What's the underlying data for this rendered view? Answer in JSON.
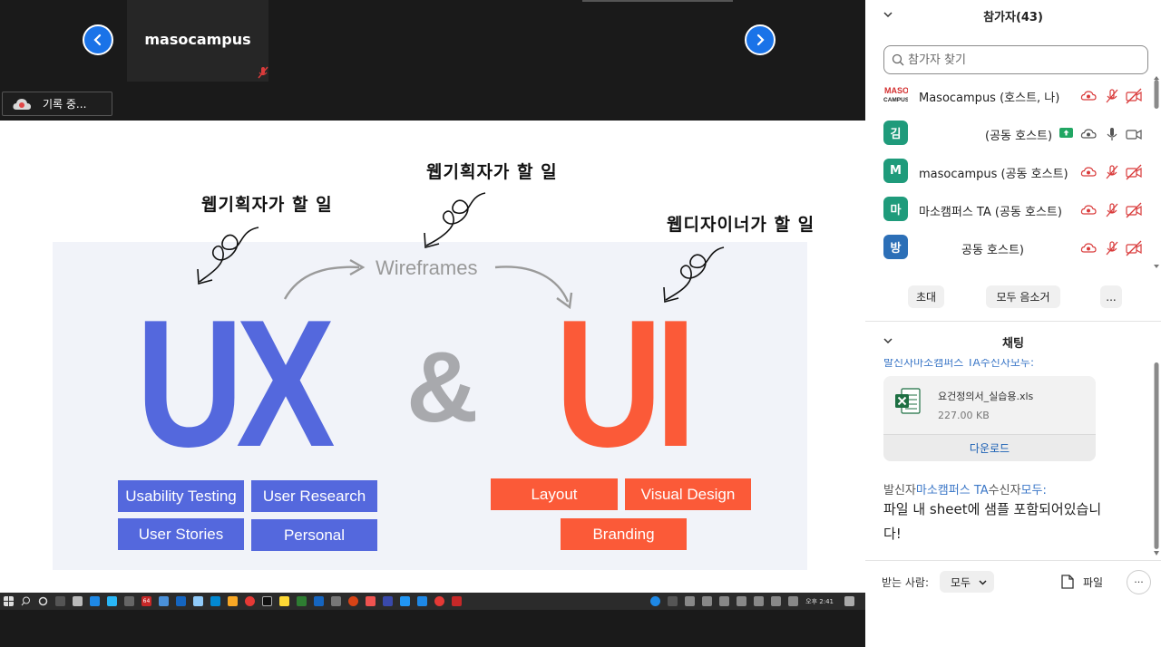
{
  "meeting": {
    "video_tile_name": "masocampus",
    "recording_label": "기록 중...",
    "slide": {
      "hand_left": "웹기획자가 할 일",
      "hand_mid": "웹기획자가 할 일",
      "hand_right": "웹디자이너가 할 일",
      "wireframes": "Wireframes",
      "ux": "UX",
      "ampersand": "&",
      "ui": "UI",
      "ux_tags": [
        "Usability Testing",
        "User Research",
        "User Stories",
        "Personal"
      ],
      "ui_tags": [
        "Layout",
        "Visual Design",
        "Branding"
      ]
    },
    "taskbar": {
      "badge": "64",
      "clock": "오후 2:41"
    }
  },
  "participants": {
    "title": "참가자(43)",
    "search_placeholder": "참가자 찾기",
    "list": [
      {
        "avatar": "MASO CAMPUS",
        "name": "Masocampus (호스트, 나)"
      },
      {
        "avatar": "김",
        "name": "(공동 호스트)"
      },
      {
        "avatar": "M",
        "name": "masocampus (공동 호스트)"
      },
      {
        "avatar": "마",
        "name": "마소캠퍼스 TA (공동 호스트)"
      },
      {
        "avatar": "방",
        "name": "공동 호스트)"
      }
    ],
    "buttons": {
      "invite": "초대",
      "mute_all": "모두 음소거",
      "more": "..."
    }
  },
  "chat": {
    "title": "채팅",
    "clipped_line": "발신자마소캠퍼스 TA수신자모두:",
    "file": {
      "name": "요건정의서_실습용.xls",
      "size": "227.00 KB",
      "download": "다운로드"
    },
    "sender_prefix": "발신자",
    "sender_name": "마소캠퍼스 TA",
    "receiver_prefix": "수신자",
    "receiver_name": "모두:",
    "message": "파일 내 sheet에 샘플 포함되어있습니다!",
    "to_label": "받는 사람:",
    "to_value": "모두",
    "file_button": "파일",
    "more_button": "···"
  },
  "colors": {
    "ux_blue": "#5468dd",
    "ui_orange": "#fb5a38",
    "zoom_blue": "#1a73e8",
    "avatar_green": "#1f9b7b",
    "avatar_blue": "#2c6fb7",
    "muted_red": "#d93b3b"
  }
}
